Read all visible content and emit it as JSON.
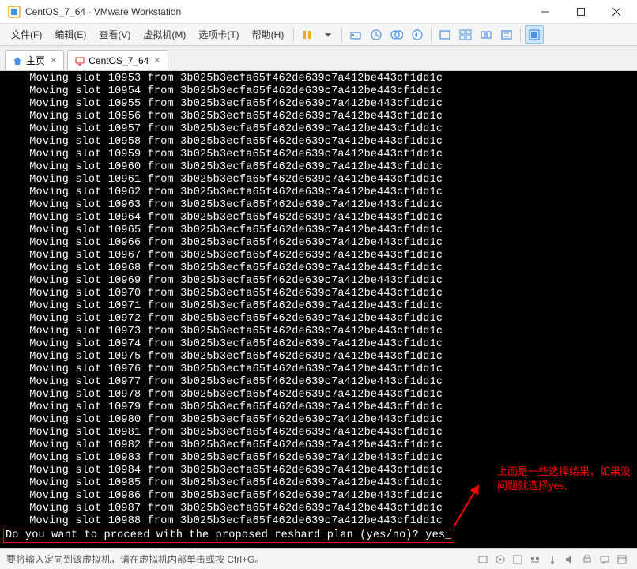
{
  "titlebar": {
    "title": "CentOS_7_64 - VMware Workstation"
  },
  "menubar": {
    "file": "文件(F)",
    "edit": "编辑(E)",
    "view": "查看(V)",
    "vm": "虚拟机(M)",
    "tabs": "选项卡(T)",
    "help": "帮助(H)"
  },
  "tabs": {
    "home": "主页",
    "vm": "CentOS_7_64"
  },
  "terminal": {
    "slot_prefix": "Moving slot ",
    "slot_mid": " from ",
    "hash": "3b025b3ecfa65f462de639c7a412be443cf1dd1c",
    "slots": [
      "10953",
      "10954",
      "10955",
      "10956",
      "10957",
      "10958",
      "10959",
      "10960",
      "10961",
      "10962",
      "10963",
      "10964",
      "10965",
      "10966",
      "10967",
      "10968",
      "10969",
      "10970",
      "10971",
      "10972",
      "10973",
      "10974",
      "10975",
      "10976",
      "10977",
      "10978",
      "10979",
      "10980",
      "10981",
      "10982",
      "10983",
      "10984",
      "10985",
      "10986",
      "10987",
      "10988"
    ],
    "prompt": "Do you want to proceed with the proposed reshard plan (yes/no)? yes_"
  },
  "annotation": {
    "line1": "上面是一些选择结果，如果没",
    "line2": "问题就选择yes,"
  },
  "statusbar": {
    "hint": "要将输入定向到该虚拟机，请在虚拟机内部单击或按 Ctrl+G。"
  }
}
